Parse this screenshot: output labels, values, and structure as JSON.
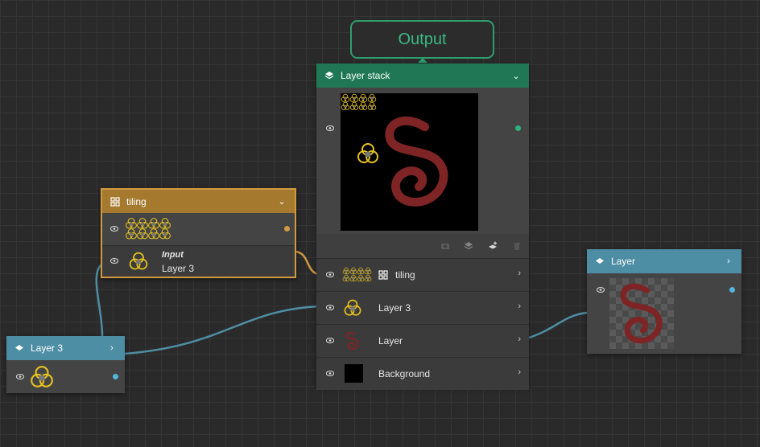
{
  "colors": {
    "canvas_bg": "#2a2a2a",
    "output_accent": "#2f9c6c",
    "layer_stack_header": "#1f7755",
    "tiling_header": "#a57a2f",
    "tiling_border": "#d19a3f",
    "layer_header": "#4e8ea5",
    "wire_blue": "#4e8ea5",
    "wire_orange": "#d19a3f",
    "swirl_red": "#7e2424",
    "knot_yellow": "#e6c21f"
  },
  "output": {
    "label": "Output"
  },
  "layer_stack": {
    "title": "Layer stack",
    "icon": "layers-icon",
    "toolbar_icons": [
      "camera-icon",
      "layers-icon",
      "add-layer-icon",
      "trash-icon"
    ],
    "layers": [
      {
        "label": "tiling",
        "icon": "grid-icon",
        "thumb": "tiled-knots"
      },
      {
        "label": "Layer 3",
        "thumb": "trefoil-knot"
      },
      {
        "label": "Layer",
        "thumb": "red-swirl"
      },
      {
        "label": "Background",
        "thumb": "black-square"
      }
    ]
  },
  "tiling": {
    "title": "tiling",
    "icon": "grid-icon",
    "input_label": "Input",
    "input_value": "Layer 3"
  },
  "layer3": {
    "title": "Layer 3",
    "icon": "layer-icon"
  },
  "layer_right": {
    "title": "Layer",
    "icon": "layer-icon"
  }
}
